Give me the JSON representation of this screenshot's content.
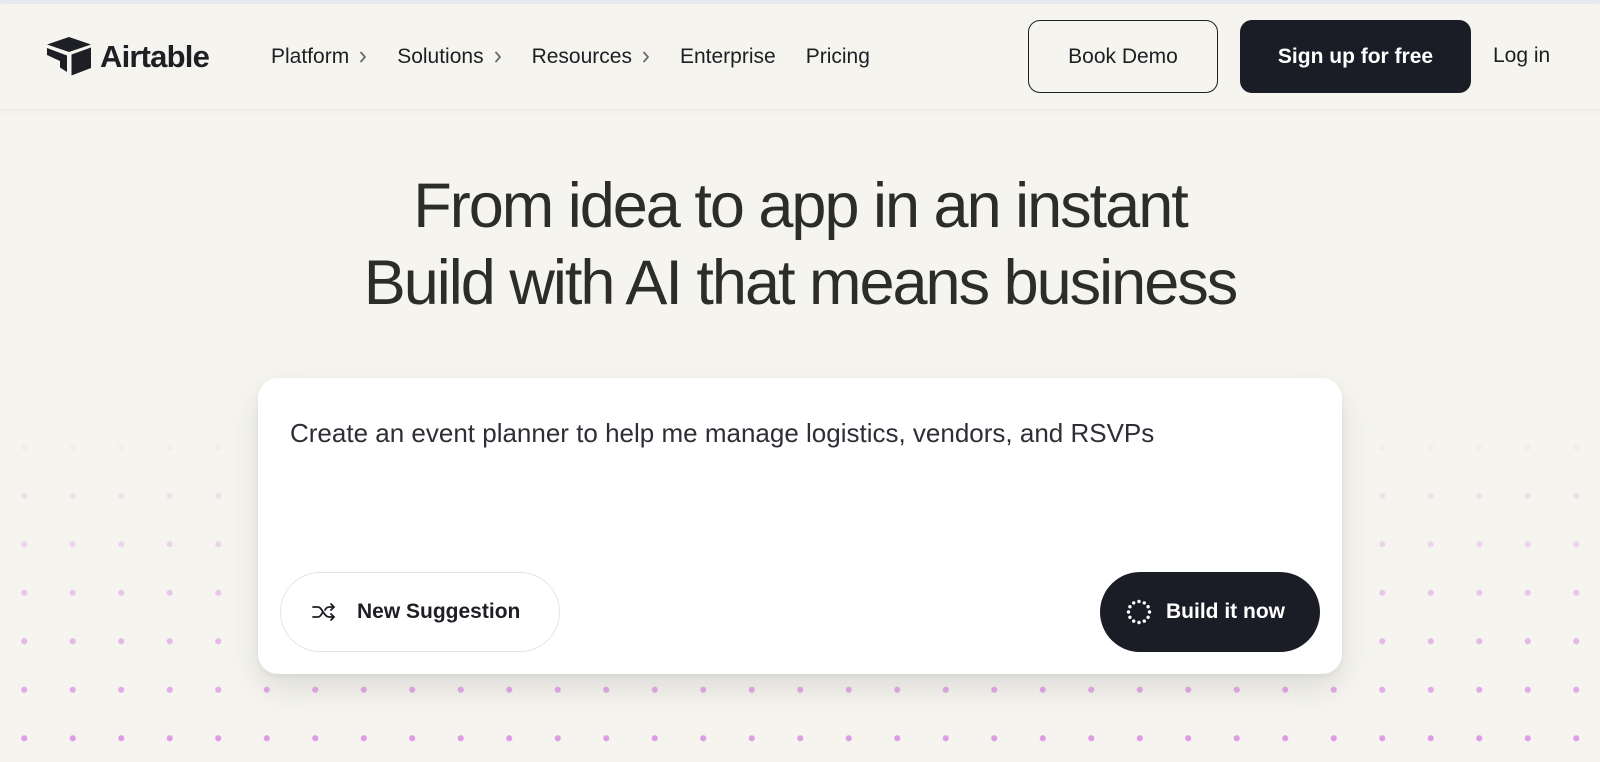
{
  "brand": {
    "name": "Airtable"
  },
  "nav": {
    "items": [
      {
        "label": "Platform",
        "has_menu": true
      },
      {
        "label": "Solutions",
        "has_menu": true
      },
      {
        "label": "Resources",
        "has_menu": true
      },
      {
        "label": "Enterprise",
        "has_menu": false
      },
      {
        "label": "Pricing",
        "has_menu": false
      }
    ],
    "book_demo_label": "Book Demo",
    "signup_label": "Sign up for free",
    "login_label": "Log in"
  },
  "hero": {
    "line1": "From idea to app in an instant",
    "line2": "Build with AI that means business"
  },
  "prompt": {
    "text": "Create an event planner to help me manage logistics, vendors, and RSVPs",
    "new_suggestion_label": "New Suggestion",
    "build_label": "Build it now"
  },
  "colors": {
    "background": "#f5f4ef",
    "dark": "#1a1d25",
    "dots": "#d678e0"
  },
  "icons": {
    "logo": "airtable-logo-icon",
    "menu": "chevron-right-icon",
    "suggestion": "shuffle-icon",
    "build": "sparkle-ring-icon"
  }
}
